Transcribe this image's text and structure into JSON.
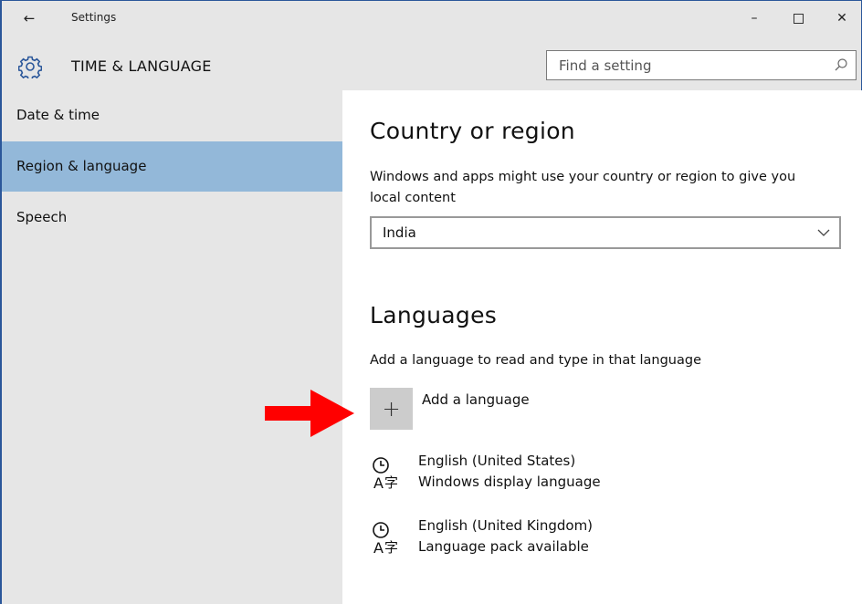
{
  "window": {
    "title": "Settings",
    "controls": {
      "minimize": "–",
      "close": "✕"
    }
  },
  "header": {
    "section_title": "TIME & LANGUAGE",
    "search_placeholder": "Find a setting"
  },
  "sidebar": {
    "items": [
      {
        "label": "Date & time",
        "selected": false
      },
      {
        "label": "Region & language",
        "selected": true
      },
      {
        "label": "Speech",
        "selected": false
      }
    ]
  },
  "region": {
    "heading": "Country or region",
    "description_line1": "Windows and apps might use your country or region to give you",
    "description_line2": "local content",
    "selected_country": "India"
  },
  "languages": {
    "heading": "Languages",
    "description": "Add a language to read and type in that language",
    "add_label": "Add a language",
    "add_icon": "+",
    "items": [
      {
        "name": "English (United States)",
        "status": "Windows display language"
      },
      {
        "name": "English (United Kingdom)",
        "status": "Language pack available"
      }
    ]
  },
  "colors": {
    "sidebar_bg": "#e6e6e6",
    "selected_bg": "#93b8d9",
    "accent": "#2b579a",
    "arrow": "#ff0000"
  }
}
